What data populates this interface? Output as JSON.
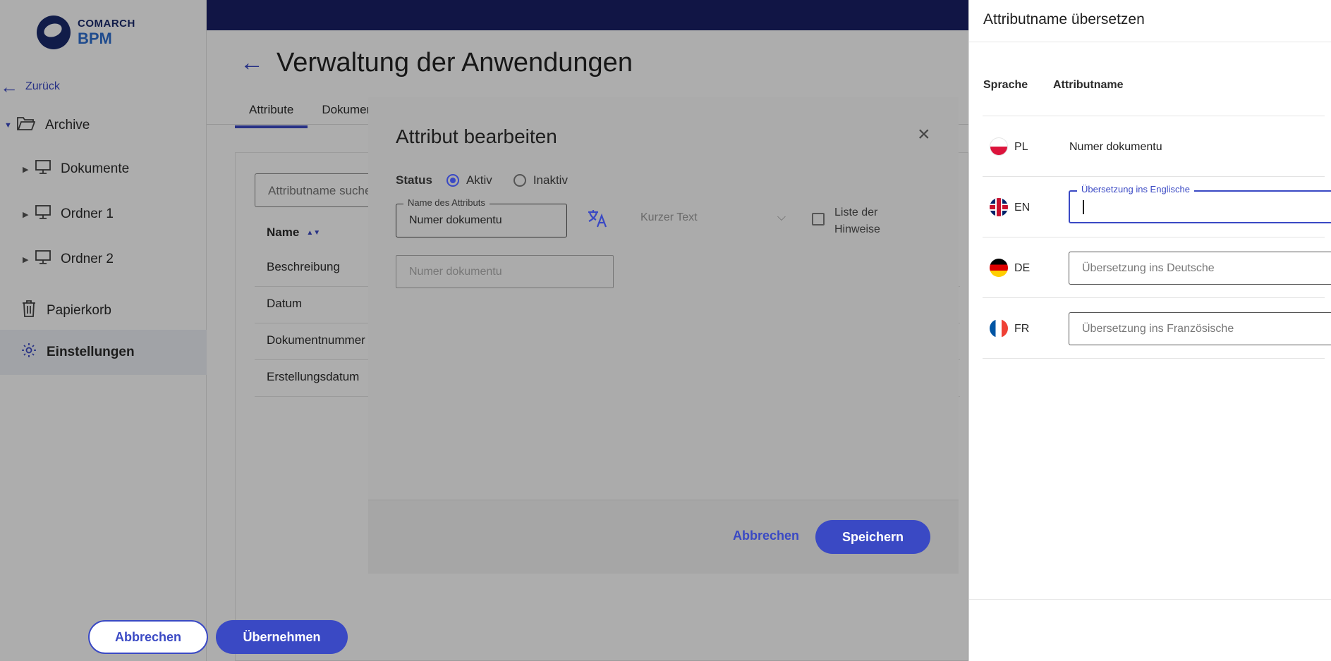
{
  "brand": {
    "line1": "COMARCH",
    "line2": "BPM"
  },
  "sidebar": {
    "back_label": "Zurück",
    "items": [
      {
        "label": "Archive"
      },
      {
        "label": "Dokumente"
      },
      {
        "label": "Ordner 1"
      },
      {
        "label": "Ordner 2"
      },
      {
        "label": "Papierkorb"
      },
      {
        "label": "Einstellungen"
      }
    ]
  },
  "page": {
    "title": "Verwaltung der Anwendungen",
    "tabs": [
      {
        "label": "Attribute"
      },
      {
        "label": "Dokumen"
      }
    ],
    "search_placeholder": "Attributname suche",
    "table": {
      "header_name": "Name",
      "rows": [
        "Beschreibung",
        "Datum",
        "Dokumentnummer",
        "Erstellungsdatum"
      ]
    }
  },
  "dialog": {
    "title": "Attribut bearbeiten",
    "close_icon": "×",
    "status_label": "Status",
    "status_options": [
      "Aktiv",
      "Inaktiv"
    ],
    "status_selected": "Aktiv",
    "name_label": "Name des Attributs",
    "name_value": "Numer dokumentu",
    "type_select": "Kurzer Text",
    "list_hints_label": "Liste der Hinweise",
    "description_placeholder": "Numer dokumentu",
    "cancel_label": "Abbrechen",
    "save_label": "Speichern"
  },
  "panel": {
    "title": "Attributname übersetzen",
    "col_language": "Sprache",
    "col_name": "Attributname",
    "rows": [
      {
        "code": "PL",
        "value": "Numer dokumentu"
      },
      {
        "code": "EN",
        "label": "Übersetzung ins Englische",
        "value": ""
      },
      {
        "code": "DE",
        "placeholder": "Übersetzung ins Deutsche"
      },
      {
        "code": "FR",
        "placeholder": "Übersetzung ins Französische"
      }
    ],
    "cancel_label": "Abbrechen",
    "apply_label": "Übernehmen"
  },
  "colors": {
    "accent": "#3a49c4",
    "topbar": "#1a2066",
    "overlay": "rgba(0,0,0,0.32)"
  }
}
